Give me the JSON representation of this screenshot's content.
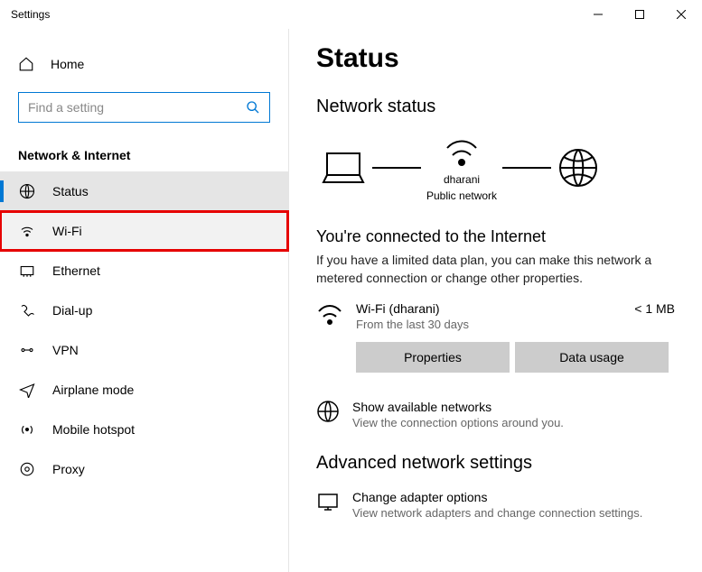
{
  "window": {
    "title": "Settings"
  },
  "sidebar": {
    "home": "Home",
    "search_placeholder": "Find a setting",
    "section": "Network & Internet",
    "items": [
      {
        "label": "Status"
      },
      {
        "label": "Wi-Fi"
      },
      {
        "label": "Ethernet"
      },
      {
        "label": "Dial-up"
      },
      {
        "label": "VPN"
      },
      {
        "label": "Airplane mode"
      },
      {
        "label": "Mobile hotspot"
      },
      {
        "label": "Proxy"
      }
    ]
  },
  "main": {
    "title": "Status",
    "subtitle": "Network status",
    "diagram": {
      "ssid": "dharani",
      "net_type": "Public network"
    },
    "connected_title": "You're connected to the Internet",
    "connected_desc": "If you have a limited data plan, you can make this network a metered connection or change other properties.",
    "connection": {
      "name": "Wi-Fi (dharani)",
      "period": "From the last 30 days",
      "usage": "< 1 MB"
    },
    "buttons": {
      "properties": "Properties",
      "data_usage": "Data usage"
    },
    "show_networks": {
      "title": "Show available networks",
      "sub": "View the connection options around you."
    },
    "advanced_title": "Advanced network settings",
    "adapter": {
      "title": "Change adapter options",
      "sub": "View network adapters and change connection settings."
    }
  }
}
